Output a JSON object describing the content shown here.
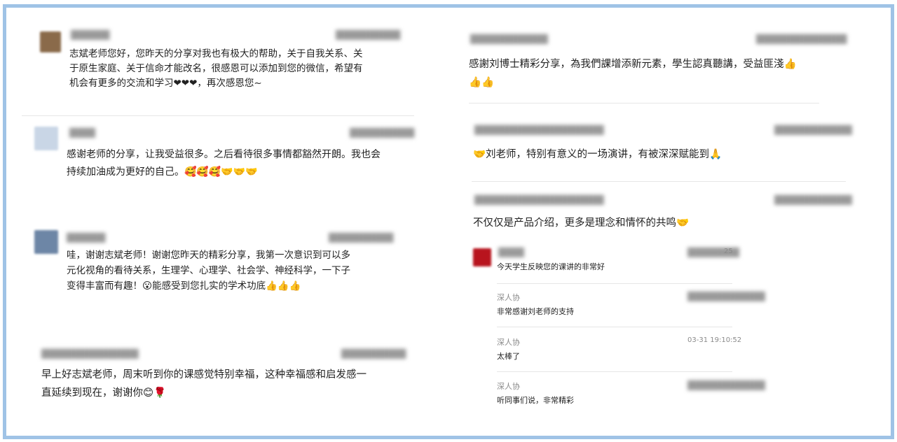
{
  "left_comments": [
    {
      "text": "志斌老师您好，您昨天的分享对我也有极大的帮助，关于自我关系、关于原生家庭、关于信命才能改名，很感恩可以添加到您的微信，希望有机会有更多的交流和学习❤❤❤，再次感恩您~"
    },
    {
      "text": "感谢老师的分享，让我受益很多。之后看待很多事情都豁然开朗。我也会持续加油成为更好的自己。🥰🥰🥰🤝🤝🤝"
    },
    {
      "text": "哇，谢谢志斌老师！谢谢您昨天的精彩分享，我第一次意识到可以多元化视角的看待关系，生理学、心理学、社会学、神经科学，一下子变得丰富而有趣！😮能感受到您扎实的学术功底👍👍👍"
    },
    {
      "text": "早上好志斌老师，周末听到你的课感觉特别幸福，这种幸福感和启发感一直延续到现在，谢谢你😊🌹"
    }
  ],
  "right_comments": [
    {
      "text": "感謝刘博士精彩分享，為我們課增添新元素，學生認真聽講，受益匪淺👍👍👍"
    },
    {
      "text": "🤝刘老师，特别有意义的一场演讲，有被深深赋能到🙏"
    },
    {
      "text": "不仅仅是产品介绍，更多是理念和情怀的共鸣🤝"
    }
  ],
  "replies": [
    {
      "name": "",
      "text": "今天学生反映您的课讲的非常好",
      "time": "25"
    },
    {
      "name": "深人协",
      "text": "非常感谢刘老师的支持",
      "time": ""
    },
    {
      "name": "深人协",
      "text": "太棒了",
      "time": "03-31 19:10:52"
    },
    {
      "name": "深人协",
      "text": "听同事们说，非常精彩",
      "time": ""
    }
  ],
  "colors": {
    "frame": "#9fc3e6"
  }
}
